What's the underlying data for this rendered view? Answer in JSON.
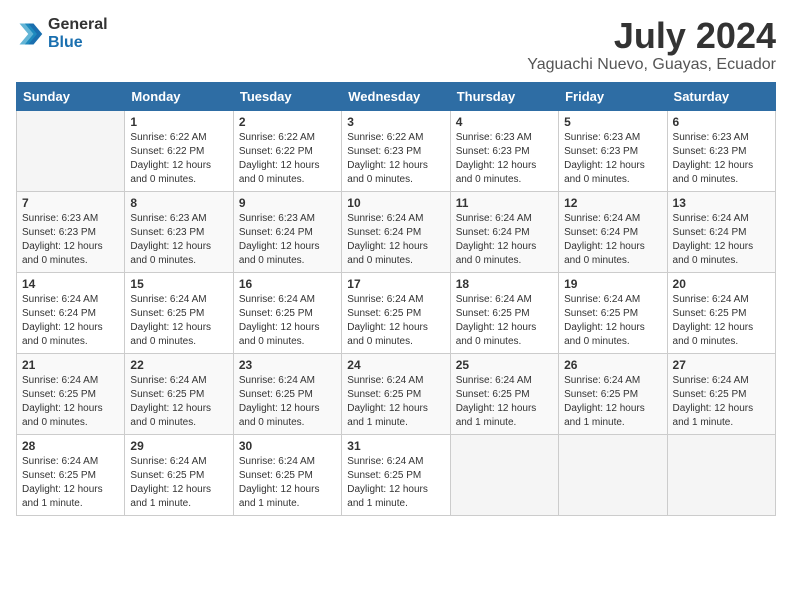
{
  "logo": {
    "general": "General",
    "blue": "Blue"
  },
  "title": {
    "month": "July 2024",
    "location": "Yaguachi Nuevo, Guayas, Ecuador"
  },
  "headers": [
    "Sunday",
    "Monday",
    "Tuesday",
    "Wednesday",
    "Thursday",
    "Friday",
    "Saturday"
  ],
  "weeks": [
    [
      {
        "day": "",
        "info": ""
      },
      {
        "day": "1",
        "info": "Sunrise: 6:22 AM\nSunset: 6:22 PM\nDaylight: 12 hours\nand 0 minutes."
      },
      {
        "day": "2",
        "info": "Sunrise: 6:22 AM\nSunset: 6:22 PM\nDaylight: 12 hours\nand 0 minutes."
      },
      {
        "day": "3",
        "info": "Sunrise: 6:22 AM\nSunset: 6:23 PM\nDaylight: 12 hours\nand 0 minutes."
      },
      {
        "day": "4",
        "info": "Sunrise: 6:23 AM\nSunset: 6:23 PM\nDaylight: 12 hours\nand 0 minutes."
      },
      {
        "day": "5",
        "info": "Sunrise: 6:23 AM\nSunset: 6:23 PM\nDaylight: 12 hours\nand 0 minutes."
      },
      {
        "day": "6",
        "info": "Sunrise: 6:23 AM\nSunset: 6:23 PM\nDaylight: 12 hours\nand 0 minutes."
      }
    ],
    [
      {
        "day": "7",
        "info": "Sunrise: 6:23 AM\nSunset: 6:23 PM\nDaylight: 12 hours\nand 0 minutes."
      },
      {
        "day": "8",
        "info": "Sunrise: 6:23 AM\nSunset: 6:23 PM\nDaylight: 12 hours\nand 0 minutes."
      },
      {
        "day": "9",
        "info": "Sunrise: 6:23 AM\nSunset: 6:24 PM\nDaylight: 12 hours\nand 0 minutes."
      },
      {
        "day": "10",
        "info": "Sunrise: 6:24 AM\nSunset: 6:24 PM\nDaylight: 12 hours\nand 0 minutes."
      },
      {
        "day": "11",
        "info": "Sunrise: 6:24 AM\nSunset: 6:24 PM\nDaylight: 12 hours\nand 0 minutes."
      },
      {
        "day": "12",
        "info": "Sunrise: 6:24 AM\nSunset: 6:24 PM\nDaylight: 12 hours\nand 0 minutes."
      },
      {
        "day": "13",
        "info": "Sunrise: 6:24 AM\nSunset: 6:24 PM\nDaylight: 12 hours\nand 0 minutes."
      }
    ],
    [
      {
        "day": "14",
        "info": "Sunrise: 6:24 AM\nSunset: 6:24 PM\nDaylight: 12 hours\nand 0 minutes."
      },
      {
        "day": "15",
        "info": "Sunrise: 6:24 AM\nSunset: 6:25 PM\nDaylight: 12 hours\nand 0 minutes."
      },
      {
        "day": "16",
        "info": "Sunrise: 6:24 AM\nSunset: 6:25 PM\nDaylight: 12 hours\nand 0 minutes."
      },
      {
        "day": "17",
        "info": "Sunrise: 6:24 AM\nSunset: 6:25 PM\nDaylight: 12 hours\nand 0 minutes."
      },
      {
        "day": "18",
        "info": "Sunrise: 6:24 AM\nSunset: 6:25 PM\nDaylight: 12 hours\nand 0 minutes."
      },
      {
        "day": "19",
        "info": "Sunrise: 6:24 AM\nSunset: 6:25 PM\nDaylight: 12 hours\nand 0 minutes."
      },
      {
        "day": "20",
        "info": "Sunrise: 6:24 AM\nSunset: 6:25 PM\nDaylight: 12 hours\nand 0 minutes."
      }
    ],
    [
      {
        "day": "21",
        "info": "Sunrise: 6:24 AM\nSunset: 6:25 PM\nDaylight: 12 hours\nand 0 minutes."
      },
      {
        "day": "22",
        "info": "Sunrise: 6:24 AM\nSunset: 6:25 PM\nDaylight: 12 hours\nand 0 minutes."
      },
      {
        "day": "23",
        "info": "Sunrise: 6:24 AM\nSunset: 6:25 PM\nDaylight: 12 hours\nand 0 minutes."
      },
      {
        "day": "24",
        "info": "Sunrise: 6:24 AM\nSunset: 6:25 PM\nDaylight: 12 hours\nand 1 minute."
      },
      {
        "day": "25",
        "info": "Sunrise: 6:24 AM\nSunset: 6:25 PM\nDaylight: 12 hours\nand 1 minute."
      },
      {
        "day": "26",
        "info": "Sunrise: 6:24 AM\nSunset: 6:25 PM\nDaylight: 12 hours\nand 1 minute."
      },
      {
        "day": "27",
        "info": "Sunrise: 6:24 AM\nSunset: 6:25 PM\nDaylight: 12 hours\nand 1 minute."
      }
    ],
    [
      {
        "day": "28",
        "info": "Sunrise: 6:24 AM\nSunset: 6:25 PM\nDaylight: 12 hours\nand 1 minute."
      },
      {
        "day": "29",
        "info": "Sunrise: 6:24 AM\nSunset: 6:25 PM\nDaylight: 12 hours\nand 1 minute."
      },
      {
        "day": "30",
        "info": "Sunrise: 6:24 AM\nSunset: 6:25 PM\nDaylight: 12 hours\nand 1 minute."
      },
      {
        "day": "31",
        "info": "Sunrise: 6:24 AM\nSunset: 6:25 PM\nDaylight: 12 hours\nand 1 minute."
      },
      {
        "day": "",
        "info": ""
      },
      {
        "day": "",
        "info": ""
      },
      {
        "day": "",
        "info": ""
      }
    ]
  ]
}
